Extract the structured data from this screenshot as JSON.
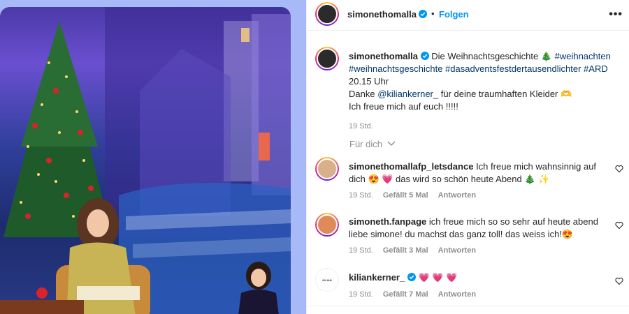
{
  "header": {
    "username": "simonethomalla",
    "separator": "•",
    "follow_label": "Folgen",
    "more_label": "•••"
  },
  "post": {
    "username": "simonethomalla",
    "line1_text": "Die Weihnachtsgeschichte 🎄",
    "tags_line1": "#weihnachten",
    "tags_line2": "#weihnachtsgeschichte #dasadventsfestdertausendlichter #ARD",
    "line_time": "20.15 Uhr",
    "thanks_pre": "Danke ",
    "thanks_mention": "@kiliankerner_",
    "thanks_post": " für deine traumhaften Kleider 🫶",
    "closing": "Ich freue mich auf euch !!!!!",
    "age": "19 Std."
  },
  "more_comments_label": "Für dich",
  "comments": [
    {
      "username": "simonethomallafp_letsdance",
      "text_a": " Ich freue mich wahnsinnig auf",
      "text_b": "dich 😍 💗 das wird so schön heute Abend 🎄 ✨",
      "age": "19 Std.",
      "likes": "Gefällt 5 Mal",
      "reply": "Antworten"
    },
    {
      "username": "simoneth.fanpage",
      "text_a": " ich freue mich so so sehr auf heute abend",
      "text_b": "liebe simone! du machst das ganz toll! das weiss ich!😍",
      "age": "19 Std.",
      "likes": "Gefällt 3 Mal",
      "reply": "Antworten"
    },
    {
      "username": "kiliankerner_",
      "text_a": " 💗 💗 💗",
      "age": "19 Std.",
      "likes": "Gefällt 7 Mal",
      "reply": "Antworten",
      "avatar_text": "KILIAN KERNER"
    }
  ],
  "colors": {
    "link_blue": "#0095f6",
    "hashtag_navy": "#00376b",
    "muted_gray": "#8e8e8e",
    "text": "#262626"
  },
  "icons": [
    "verified-badge-icon",
    "more-options-icon",
    "chevron-down-icon",
    "heart-icon"
  ]
}
